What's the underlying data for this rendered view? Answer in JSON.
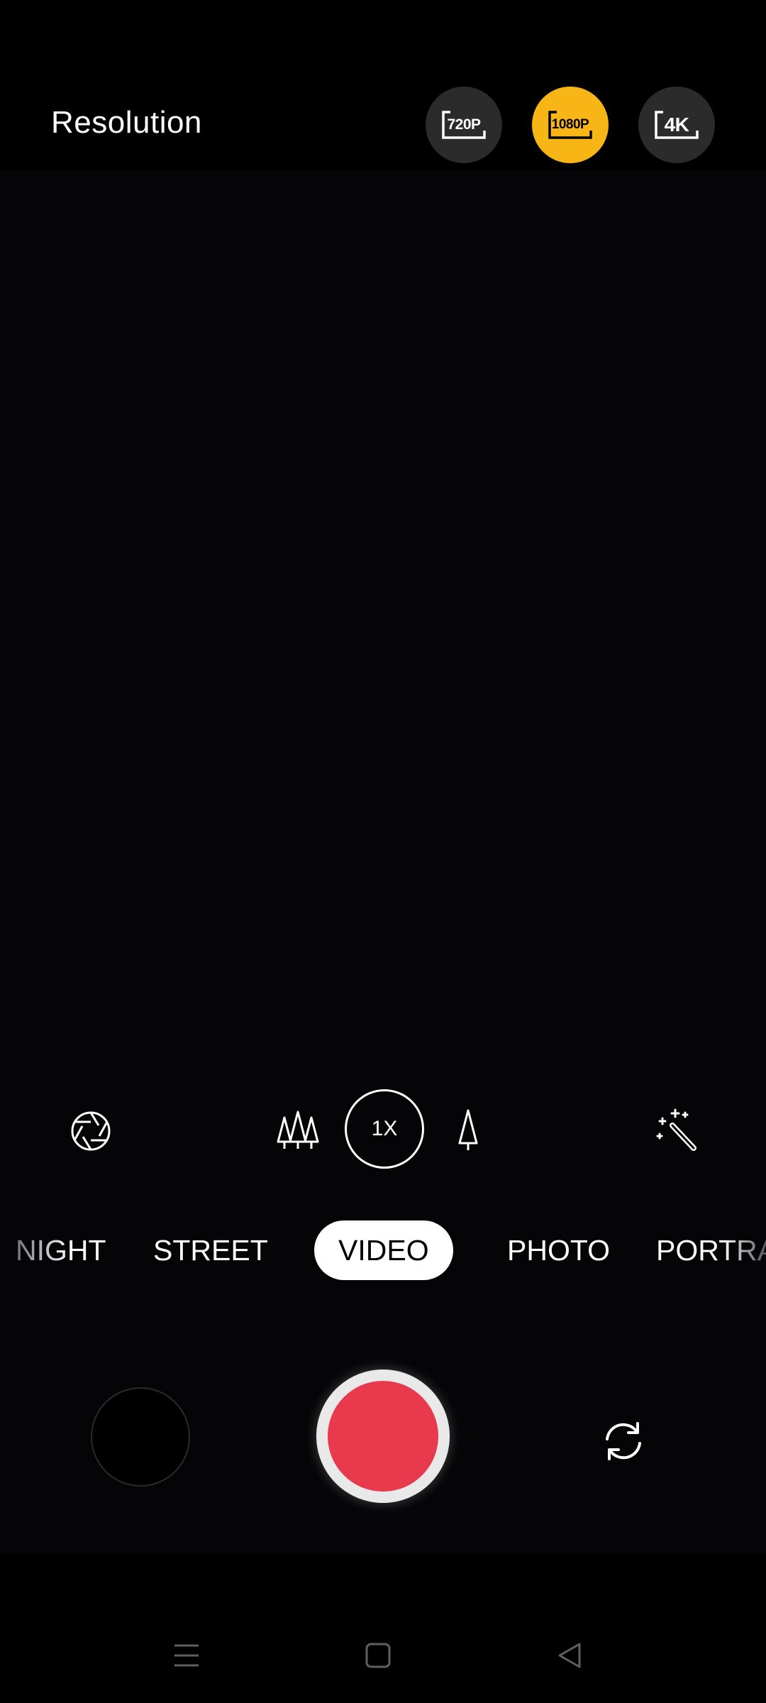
{
  "resolution": {
    "label": "Resolution",
    "options": [
      {
        "label": "720P",
        "selected": false
      },
      {
        "label": "1080P",
        "selected": true
      },
      {
        "label": "4K",
        "selected": false
      }
    ],
    "accent_color": "#f8b616"
  },
  "tools": {
    "left_icon": "aperture-icon",
    "wide_icon": "trees-wide-icon",
    "zoom_label": "1X",
    "tele_icon": "tree-tele-icon",
    "right_icon": "magic-wand-icon"
  },
  "modes": {
    "items": [
      "NIGHT",
      "STREET",
      "VIDEO",
      "PHOTO",
      "PORTRA"
    ],
    "active": "VIDEO"
  },
  "capture": {
    "record_color": "#e83a4c",
    "switch_icon": "switch-camera-icon"
  },
  "navbar": {
    "menu_icon": "menu-icon",
    "home_icon": "home-icon",
    "back_icon": "back-icon"
  }
}
